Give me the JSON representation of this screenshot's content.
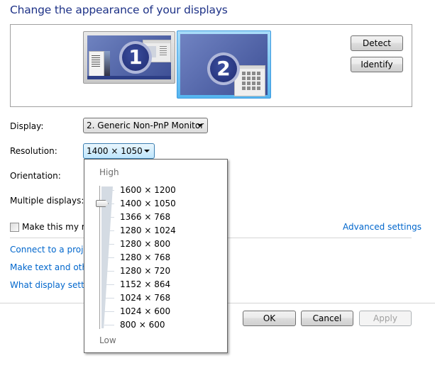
{
  "page": {
    "title": "Change the appearance of your displays"
  },
  "monitors": [
    {
      "number": "1",
      "selected": false
    },
    {
      "number": "2",
      "selected": true
    }
  ],
  "monitor_buttons": {
    "detect": "Detect",
    "identify": "Identify"
  },
  "form": {
    "display_label": "Display:",
    "display_value": "2. Generic Non-PnP Monitor",
    "resolution_label": "Resolution:",
    "resolution_value": "1400 × 1050",
    "orientation_label": "Orientation:",
    "multiple_displays_label": "Multiple displays:",
    "main_display_checkbox_label": "Make this my main display",
    "main_display_checked": false
  },
  "links": {
    "advanced_settings": "Advanced settings",
    "connect_projector": "Connect to a projector",
    "make_text_larger": "Make text and other items larger or smaller",
    "what_settings": "What display settings should I choose?"
  },
  "resolution_dropdown": {
    "high_label": "High",
    "low_label": "Low",
    "options": [
      "1600 × 1200",
      "1400 × 1050",
      "1366 × 768",
      "1280 × 1024",
      "1280 × 800",
      "1280 × 768",
      "1280 × 720",
      "1152 × 864",
      "1024 × 768",
      "1024 × 600",
      "800 × 600"
    ],
    "selected_index": 1
  },
  "dialog_buttons": {
    "ok": "OK",
    "cancel": "Cancel",
    "apply": "Apply",
    "apply_enabled": false
  }
}
